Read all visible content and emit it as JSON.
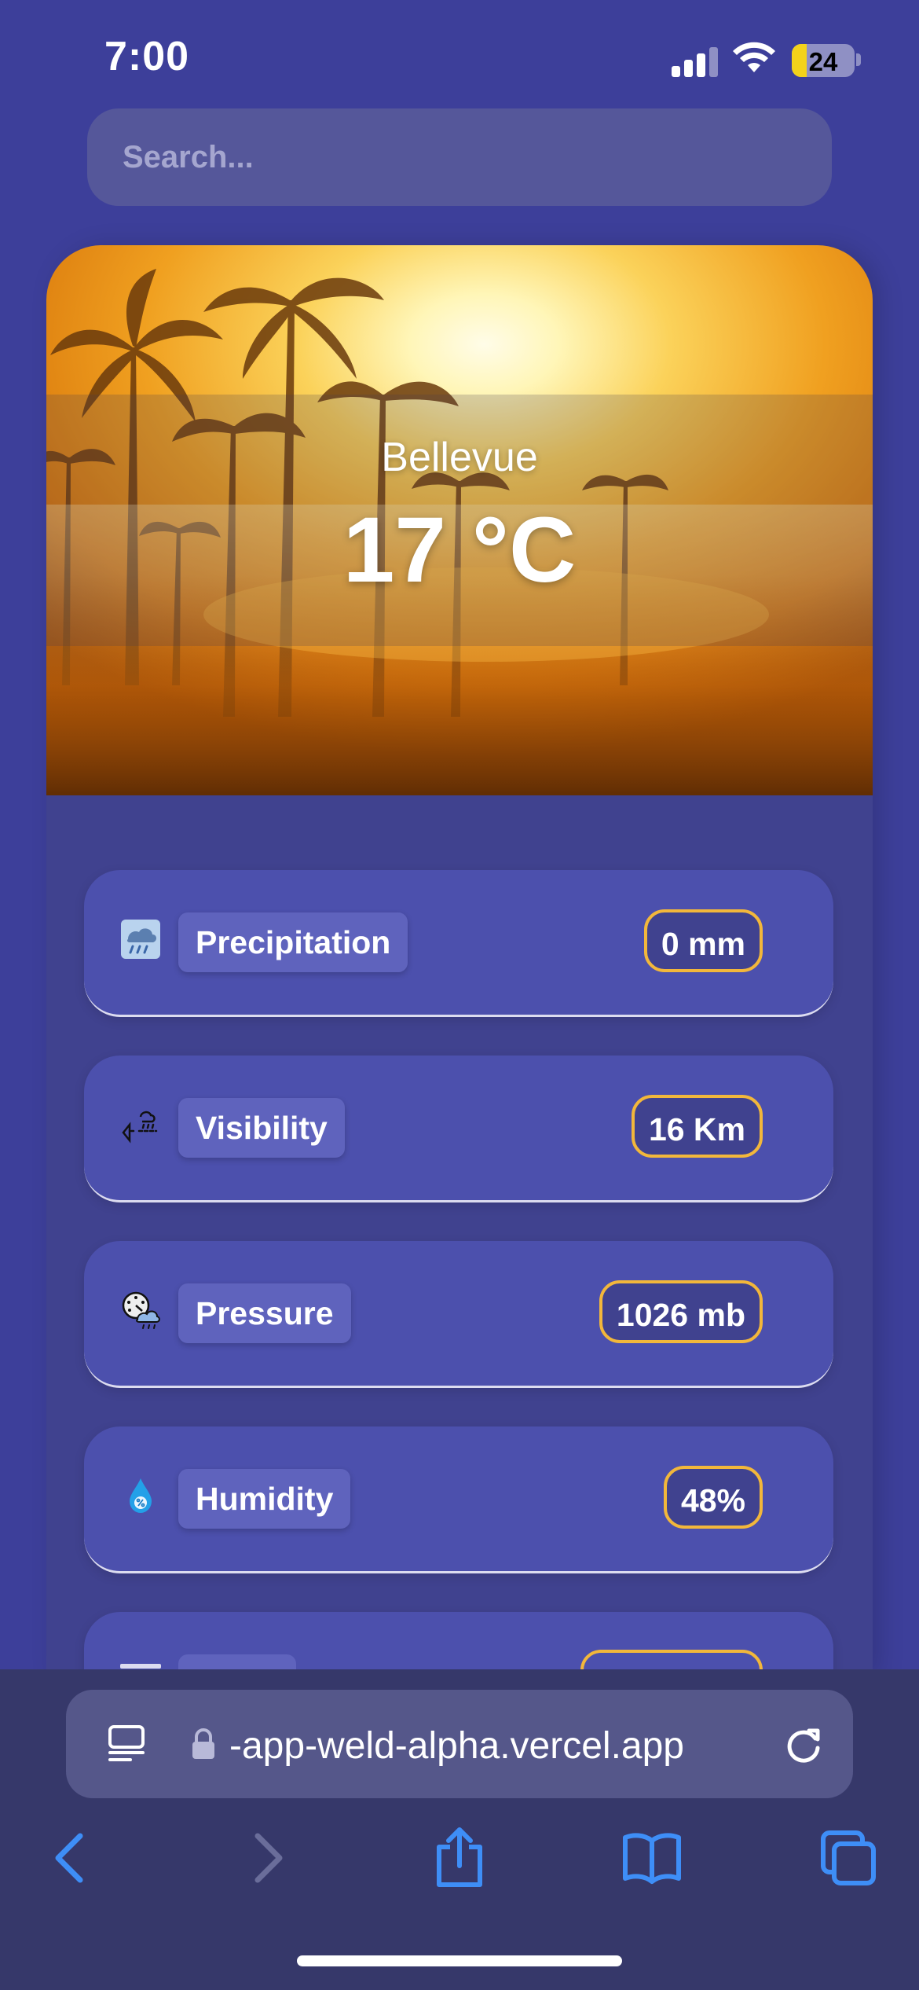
{
  "status_bar": {
    "time": "7:00",
    "battery": "24"
  },
  "search": {
    "placeholder": "Search..."
  },
  "hero": {
    "city": "Bellevue",
    "temperature": "17 °C"
  },
  "details": [
    {
      "label": "Precipitation",
      "value": "0 mm",
      "icon": "rain-cloud-icon"
    },
    {
      "label": "Visibility",
      "value": "16 Km",
      "icon": "wind-rain-icon"
    },
    {
      "label": "Pressure",
      "value": "1026 mb",
      "icon": "pressure-icon"
    },
    {
      "label": "Humidity",
      "value": "48%",
      "icon": "humidity-drop-icon"
    }
  ],
  "browser": {
    "url": "-app-weld-alpha.vercel.app"
  },
  "colors": {
    "background": "#3d3f9a",
    "row": "#4c50ad",
    "value_border": "#f2b73b",
    "browser_bar": "#36386a",
    "accent_blue": "#3e8ef7"
  }
}
